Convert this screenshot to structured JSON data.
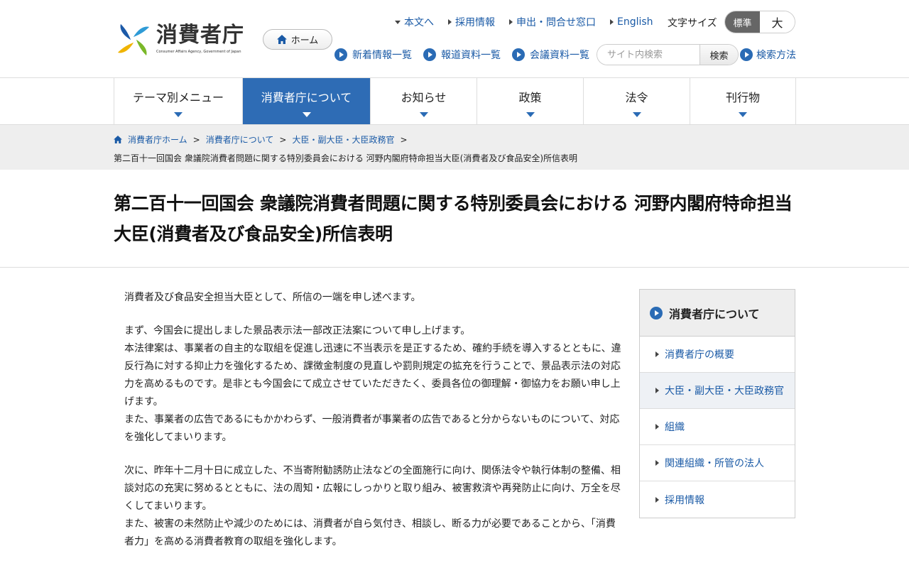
{
  "logo": {
    "name": "消費者庁",
    "subtitle": "Consumer Affairs Agency, Government of Japan"
  },
  "home_button": "ホーム",
  "top_links": [
    {
      "label": "本文へ",
      "icon": "triangle-down-icon"
    },
    {
      "label": "採用情報",
      "icon": "triangle-right-icon"
    },
    {
      "label": "申出・問合せ窓口",
      "icon": "triangle-right-icon"
    },
    {
      "label": "English",
      "icon": "triangle-right-icon"
    }
  ],
  "font_size": {
    "label": "文字サイズ",
    "standard": "標準",
    "large": "大",
    "selected": "標準"
  },
  "sub_links": [
    {
      "label": "新着情報一覧"
    },
    {
      "label": "報道資料一覧"
    },
    {
      "label": "会議資料一覧"
    }
  ],
  "search": {
    "placeholder": "サイト内検索",
    "button": "検索",
    "help": "検索方法"
  },
  "global_nav": [
    {
      "label": "テーマ別メニュー",
      "active": false
    },
    {
      "label": "消費者庁について",
      "active": true
    },
    {
      "label": "お知らせ",
      "active": false
    },
    {
      "label": "政策",
      "active": false
    },
    {
      "label": "法令",
      "active": false
    },
    {
      "label": "刊行物",
      "active": false
    }
  ],
  "breadcrumb": {
    "items": [
      "消費者庁ホーム",
      "消費者庁について",
      "大臣・副大臣・大臣政務官"
    ],
    "current": "第二百十一回国会 衆議院消費者問題に関する特別委員会における 河野内閣府特命担当大臣(消費者及び食品安全)所信表明"
  },
  "page_title": "第二百十一回国会 衆議院消費者問題に関する特別委員会における 河野内閣府特命担当大臣(消費者及び食品安全)所信表明",
  "body": {
    "p1": "消費者及び食品安全担当大臣として、所信の一端を申し述べます。",
    "p2a": "まず、今国会に提出しました景品表示法一部改正法案について申し上げます。",
    "p2b": "本法律案は、事業者の自主的な取組を促進し迅速に不当表示を是正するため、確約手続を導入するとともに、違反行為に対する抑止力を強化するため、課徴金制度の見直しや罰則規定の拡充を行うことで、景品表示法の対応力を高めるものです。是非とも今国会にて成立させていただきたく、委員各位の御理解・御協力をお願い申し上げます。",
    "p2c": "また、事業者の広告であるにもかかわらず、一般消費者が事業者の広告であると分からないものについて、対応を強化してまいります。",
    "p3a": "次に、昨年十二月十日に成立した、不当寄附勧誘防止法などの全面施行に向け、関係法令や執行体制の整備、相談対応の充実に努めるとともに、法の周知・広報にしっかりと取り組み、被害救済や再発防止に向け、万全を尽くしてまいります。",
    "p3b": "また、被害の未然防止や減少のためには、消費者が自ら気付き、相談し、断る力が必要であることから、「消費者力」を高める消費者教育の取組を強化します。"
  },
  "sidebar": {
    "title": "消費者庁について",
    "items": [
      {
        "label": "消費者庁の概要",
        "current": false
      },
      {
        "label": "大臣・副大臣・大臣政務官",
        "current": true
      },
      {
        "label": "組織",
        "current": false
      },
      {
        "label": "関連組織・所管の法人",
        "current": false
      },
      {
        "label": "採用情報",
        "current": false
      }
    ]
  },
  "colors": {
    "accent": "#2e6cb5",
    "link": "#1a5aa6",
    "breadcrumb_bg": "#eeeeee"
  }
}
